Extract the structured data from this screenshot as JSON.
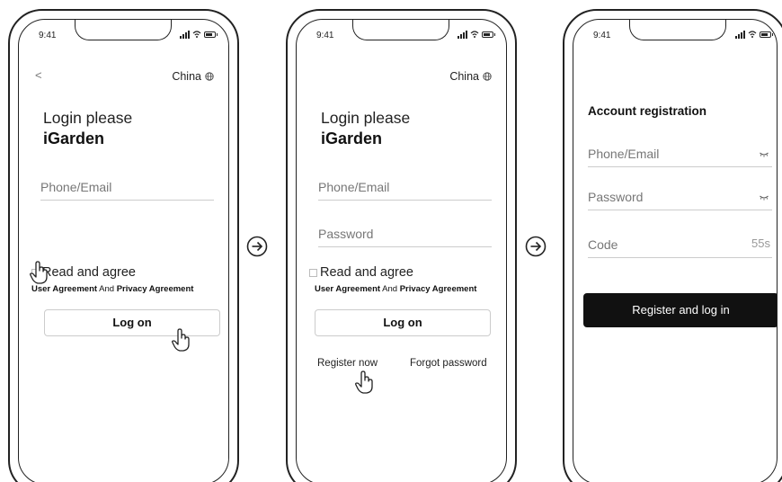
{
  "status_bar": {
    "time": "9:41"
  },
  "screen1": {
    "back_glyph": "<",
    "region": "China",
    "title_line1": "Login please",
    "title_line2": "iGarden",
    "phone_placeholder": "Phone/Email",
    "agree_label": "Read and agree",
    "user_agreement": "User Agreement",
    "and": "And",
    "privacy_agreement": "Privacy Agreement",
    "login_button": "Log on"
  },
  "screen2": {
    "region": "China",
    "title_line1": "Login please",
    "title_line2": "iGarden",
    "phone_placeholder": "Phone/Email",
    "password_placeholder": "Password",
    "agree_label": "Read and agree",
    "user_agreement": "User Agreement",
    "and": "And",
    "privacy_agreement": "Privacy Agreement",
    "login_button": "Log on",
    "register_link": "Register now",
    "forgot_link": "Forgot password"
  },
  "screen3": {
    "title": "Account registration",
    "phone_placeholder": "Phone/Email",
    "password_placeholder": "Password",
    "code_placeholder": "Code",
    "code_countdown": "55s",
    "register_button": "Register and log in"
  },
  "icons": {
    "flow_arrow": "arrow-right-circle-icon",
    "region": "globe-icon",
    "pointer": "hand-pointer-icon",
    "visibility": "eye-closed-icon"
  }
}
